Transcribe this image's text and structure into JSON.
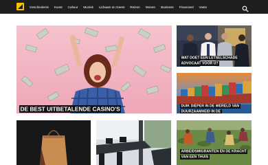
{
  "header": {
    "logo_icon": "site-logo-icon",
    "nav_items": [
      "Geschiedenis",
      "Kunst",
      "Cultuur",
      "Muziek",
      "Lichaam en Geest",
      "Reizen",
      "Wonen",
      "Business",
      "Financieel",
      "Vaste"
    ],
    "search_icon": "search-icon"
  },
  "featured": {
    "title": "DE BEST UITBETALENDE CASINO'S"
  },
  "side_articles": [
    {
      "title": "WAT DOET EEN LETSELSCHADE ADVOCAAT VOOR U?"
    },
    {
      "title": "DUIK DIEPER IN DE WERELD VAN DUURZAAMHEID IN DE TRANSPORTSECTOR"
    }
  ],
  "bottom_articles": [
    {
      "title": ""
    },
    {
      "title": ""
    },
    {
      "title": "ARBEIDSMIGRANTEN EN DE KRACHT VAN EEN THUIS"
    }
  ],
  "colors": {
    "topbar": "#1f1f1f",
    "accent": "#f5c400",
    "featured_bg": "#f3b4c3"
  }
}
